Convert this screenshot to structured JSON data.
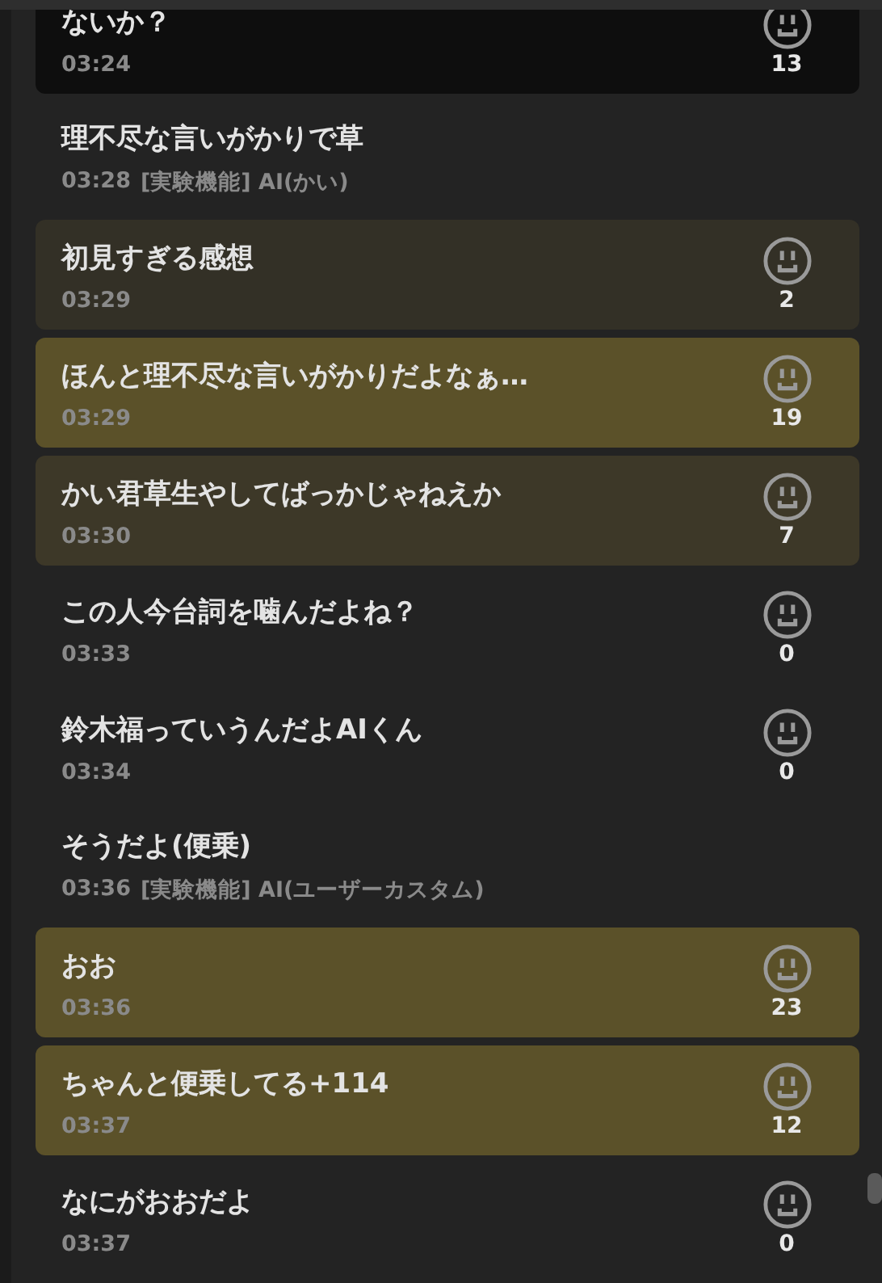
{
  "comments": [
    {
      "kind": "comment",
      "text": "ないか？",
      "time": "03:24",
      "count": "13",
      "color": "#0e0e0e"
    },
    {
      "kind": "ai",
      "text": "理不尽な言いがかりで草",
      "time": "03:28",
      "label": "[実験機能] AI(かい)"
    },
    {
      "kind": "comment",
      "text": "初見すぎる感想",
      "time": "03:29",
      "count": "2",
      "color": "#333026"
    },
    {
      "kind": "comment",
      "text": "ほんと理不尽な言いがかりだよなぁ…",
      "time": "03:29",
      "count": "19",
      "color": "#5b5129"
    },
    {
      "kind": "comment",
      "text": "かい君草生やしてばっかじゃねえか",
      "time": "03:30",
      "count": "7",
      "color": "#3d3828"
    },
    {
      "kind": "comment",
      "text": "この人今台詞を噛んだよね？",
      "time": "03:33",
      "count": "0"
    },
    {
      "kind": "comment",
      "text": "鈴木福っていうんだよAIくん",
      "time": "03:34",
      "count": "0"
    },
    {
      "kind": "ai",
      "text": "そうだよ(便乗)",
      "time": "03:36",
      "label": "[実験機能] AI(ユーザーカスタム)"
    },
    {
      "kind": "comment",
      "text": "おお",
      "time": "03:36",
      "count": "23",
      "color": "#5b5129"
    },
    {
      "kind": "comment",
      "text": "ちゃんと便乗してる+114",
      "time": "03:37",
      "count": "12",
      "color": "#5b5129"
    },
    {
      "kind": "comment",
      "text": "なにがおおだよ",
      "time": "03:37",
      "count": "0"
    }
  ]
}
